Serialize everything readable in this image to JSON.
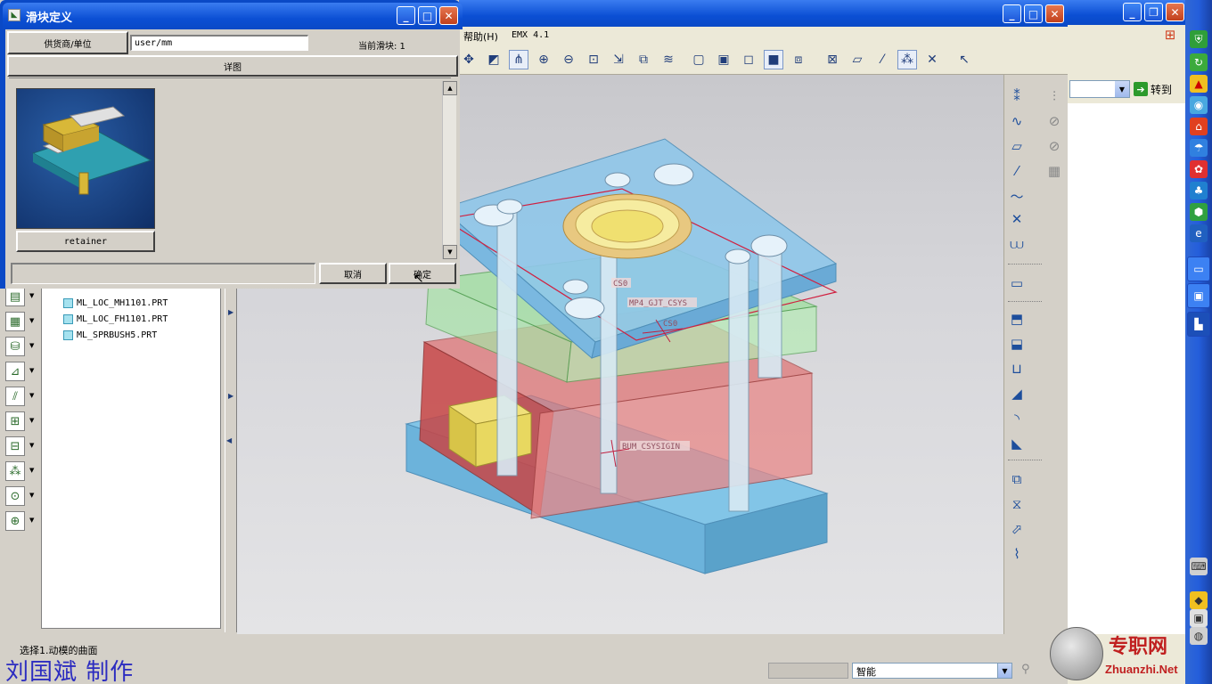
{
  "dialog": {
    "title": "滑块定义",
    "supplier_units_label": "供货商/单位",
    "units_value": "user/mm",
    "current_slider_label": "当前滑块: 1",
    "detail_label": "详图",
    "thumbnail_caption": "retainer",
    "cancel_label": "取消",
    "ok_label": "确定",
    "message_value": ""
  },
  "main_window": {
    "menu": {
      "help_label": "帮助(H)",
      "emx_label": "EMX 4.1"
    }
  },
  "model_tree": {
    "items": [
      {
        "label": "ML_LOC_MH1101.PRT"
      },
      {
        "label": "ML_LOC_FH1101.PRT"
      },
      {
        "label": "ML_SPRBUSH5.PRT"
      }
    ]
  },
  "viewport": {
    "labels": {
      "mp4_csys": "MP4_GJT_CSYS",
      "cs0_top": "CS0",
      "cs0_mid": "CS0",
      "bum_csys": "BUM_CSYSIGIN"
    },
    "colors": {
      "top_plate": "#8fc7ea",
      "cavity_plate": "#9fe09f",
      "core_plate": "#e07070",
      "bottom_plate": "#7ec4e8",
      "slider": "#e8d86a",
      "locating_ring": "#e8c880"
    }
  },
  "status": {
    "message": "选择1.动模的曲面",
    "author": "刘国斌 制作",
    "smart_filter": "智能"
  },
  "browser": {
    "go_label": "转到",
    "watermark_cn": "专职网",
    "watermark_en": "Zhuanzhi.Net"
  },
  "accent_colors": {
    "xp_blue": "#0a49c6",
    "xp_close": "#c1401c",
    "face": "#d4d0c8"
  }
}
